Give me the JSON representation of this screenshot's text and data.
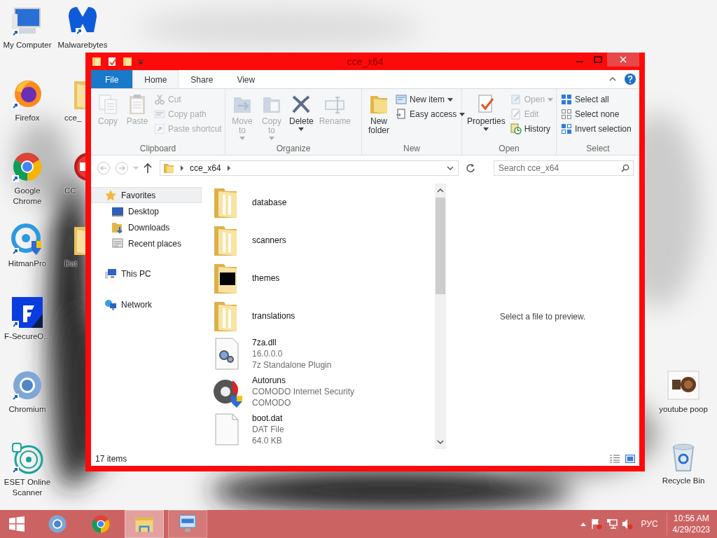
{
  "desktop": {
    "column_1": [
      {
        "label": "My Computer"
      },
      {
        "label": "Firefox"
      },
      {
        "label": "Google Chrome"
      },
      {
        "label": "HitmanPro"
      },
      {
        "label": "F-SecureO..."
      },
      {
        "label": "Chromium"
      },
      {
        "label": "ESET Online Scanner"
      }
    ],
    "column_2": [
      {
        "label": "Malwarebytes"
      },
      {
        "label": "cce_"
      },
      {
        "label": "CC"
      },
      {
        "label": "Dat"
      }
    ],
    "right": [
      {
        "label": "youtube poop"
      },
      {
        "label": "Recycle Bin"
      }
    ]
  },
  "window": {
    "title": "cce_x64",
    "ribbon_tabs": [
      {
        "label": "File",
        "kind": "menu",
        "selected": false
      },
      {
        "label": "Home",
        "kind": "tab",
        "selected": true
      },
      {
        "label": "Share",
        "kind": "tab",
        "selected": false
      },
      {
        "label": "View",
        "kind": "tab",
        "selected": false
      }
    ],
    "ribbon_groups": [
      {
        "label": "Clipboard",
        "buttons": [
          {
            "label": "Copy",
            "kind": "large",
            "disabled": true,
            "menu": false
          },
          {
            "label": "Paste",
            "kind": "large",
            "disabled": true,
            "menu": false
          },
          {
            "label": "Cut",
            "kind": "small",
            "disabled": true,
            "menu": false
          },
          {
            "label": "Copy path",
            "kind": "small",
            "disabled": true,
            "menu": false
          },
          {
            "label": "Paste shortcut",
            "kind": "small",
            "disabled": true,
            "menu": false
          }
        ]
      },
      {
        "label": "Organize",
        "buttons": [
          {
            "label": "Move to",
            "kind": "large",
            "disabled": true,
            "menu": true
          },
          {
            "label": "Copy to",
            "kind": "large",
            "disabled": true,
            "menu": true
          },
          {
            "label": "Delete",
            "kind": "large",
            "disabled": false,
            "menu": true
          },
          {
            "label": "Rename",
            "kind": "large",
            "disabled": true,
            "menu": false
          }
        ]
      },
      {
        "label": "New",
        "buttons": [
          {
            "label": "New folder",
            "kind": "large",
            "disabled": false,
            "menu": false
          },
          {
            "label": "New item",
            "kind": "small",
            "disabled": false,
            "menu": true
          },
          {
            "label": "Easy access",
            "kind": "small",
            "disabled": false,
            "menu": true
          }
        ]
      },
      {
        "label": "Open",
        "buttons": [
          {
            "label": "Properties",
            "kind": "large",
            "disabled": false,
            "menu": true
          },
          {
            "label": "Open",
            "kind": "small",
            "disabled": true,
            "menu": true
          },
          {
            "label": "Edit",
            "kind": "small",
            "disabled": true,
            "menu": false
          },
          {
            "label": "History",
            "kind": "small",
            "disabled": false,
            "menu": false
          }
        ]
      },
      {
        "label": "Select",
        "buttons": [
          {
            "label": "Select all",
            "kind": "small",
            "disabled": false,
            "menu": false
          },
          {
            "label": "Select none",
            "kind": "small",
            "disabled": false,
            "menu": false
          },
          {
            "label": "Invert selection",
            "kind": "small",
            "disabled": false,
            "menu": false
          }
        ]
      }
    ],
    "address": {
      "path": "cce_x64"
    },
    "search": {
      "placeholder": "Search cce_x64"
    },
    "nav": [
      {
        "label": "Favorites",
        "selected": true,
        "children": [
          {
            "label": "Desktop",
            "selected": false
          },
          {
            "label": "Downloads",
            "selected": false
          },
          {
            "label": "Recent places",
            "selected": false
          }
        ]
      },
      {
        "label": "This PC",
        "selected": false
      },
      {
        "label": "Network",
        "selected": false
      }
    ],
    "files": [
      {
        "kind": "folder",
        "name": "database"
      },
      {
        "kind": "folder",
        "name": "scanners"
      },
      {
        "kind": "folder",
        "name": "themes"
      },
      {
        "kind": "folder",
        "name": "translations"
      },
      {
        "kind": "file",
        "name": "7za.dll",
        "details": [
          "16.0.0.0",
          "7z Standalone Plugin"
        ]
      },
      {
        "kind": "file",
        "name": "Autoruns",
        "details": [
          "COMODO Internet Security",
          "COMODO"
        ]
      },
      {
        "kind": "file",
        "name": "boot.dat",
        "details": [
          "DAT File",
          "64.0 KB"
        ]
      }
    ],
    "preview_text": "Select a file to preview.",
    "status": "17 items"
  },
  "taskbar": {
    "apps": [
      {
        "selected": false,
        "running": false
      },
      {
        "selected": false,
        "running": false
      },
      {
        "selected": false,
        "running": false
      },
      {
        "selected": true,
        "running": true
      },
      {
        "selected": false,
        "running": true
      }
    ],
    "language": "РУС",
    "time": "10:56 AM",
    "date": "4/29/2023"
  }
}
